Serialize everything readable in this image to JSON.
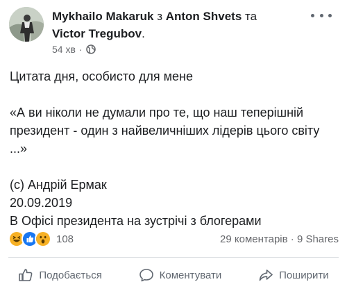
{
  "post": {
    "author": "Mykhailo Makaruk",
    "with_word": "з",
    "tagged_1": "Anton Shvets",
    "and_word": "та",
    "tagged_2": "Victor Tregubov",
    "period": ".",
    "time": "54 хв",
    "separator": "·",
    "privacy_icon": "globe-icon",
    "text": {
      "line1": "Цитата дня, особисто для мене",
      "quote": "«А ви ніколи не думали про те, що наш теперішній президент - один з найвеличніших лідерів цього світу ...»",
      "attribution": "(c) Андрій Ермак",
      "date": "20.09.2019",
      "place": "В Офісі президента на зустрічі з блогерами"
    }
  },
  "stats": {
    "reaction_icons": [
      "haha-icon",
      "like-icon",
      "wow-icon"
    ],
    "reaction_count": "108",
    "comments": "29 коментарів",
    "dot": "·",
    "shares": "9 Shares"
  },
  "actions": {
    "like": "Подобається",
    "comment": "Коментувати",
    "share": "Поширити"
  },
  "colors": {
    "text": "#1c1e21",
    "secondary": "#65676b",
    "like_blue": "#1877f2",
    "haha_yellow": "#f7b125",
    "divider": "#dadde1"
  }
}
